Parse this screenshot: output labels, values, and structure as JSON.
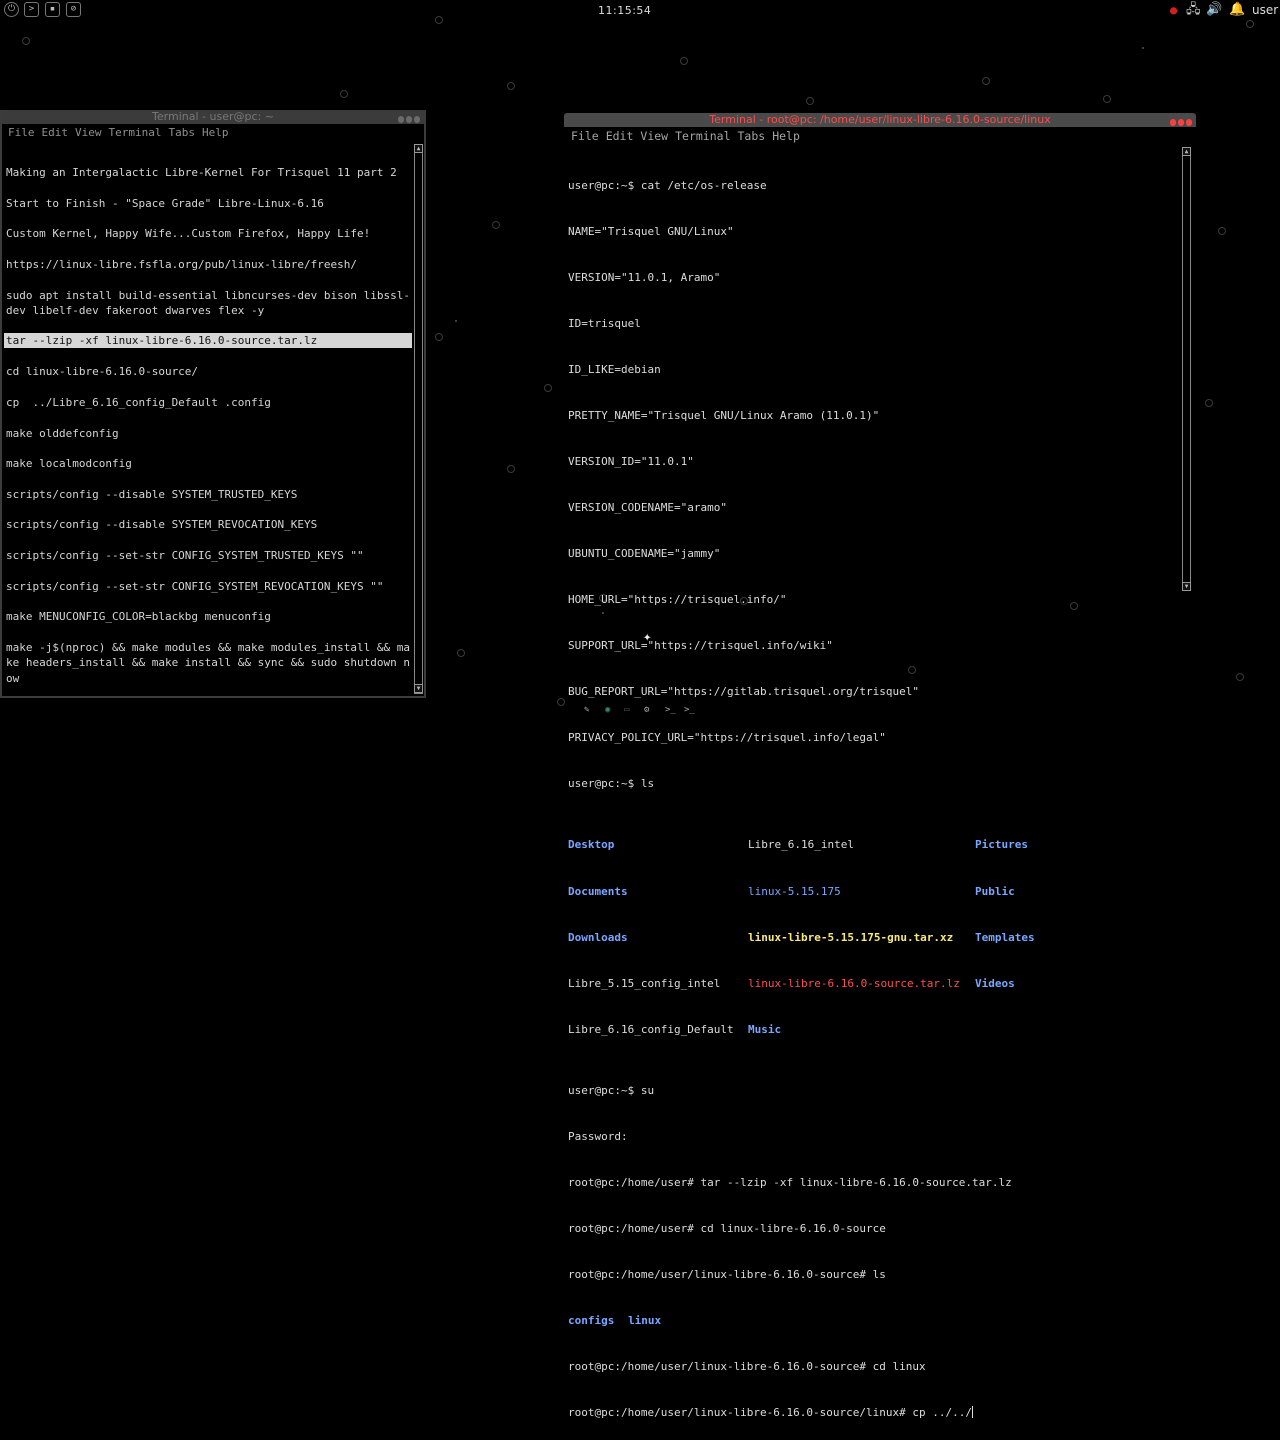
{
  "top_panel": {
    "clock": "11:15:54",
    "user": "user",
    "left_icons": [
      "power-icon",
      "terminal-icon",
      "folder-icon",
      "pen-icon"
    ],
    "tray_icons": [
      "record-icon",
      "network-icon",
      "volume-icon",
      "bell-icon"
    ]
  },
  "left_terminal": {
    "title": "Terminal - user@pc: ~",
    "menu": [
      "File",
      "Edit",
      "View",
      "Terminal",
      "Tabs",
      "Help"
    ],
    "lines": [
      "Making an Intergalactic Libre-Kernel For Trisquel 11 part 2",
      "Start to Finish - \"Space Grade\" Libre-Linux-6.16",
      "Custom Kernel, Happy Wife...Custom Firefox, Happy Life!",
      "https://linux-libre.fsfla.org/pub/linux-libre/freesh/",
      "sudo apt install build-essential libncurses-dev bison libssl-",
      "dev libelf-dev fakeroot dwarves flex -y",
      "tar --lzip -xf linux-libre-6.16.0-source.tar.lz",
      "cd linux-libre-6.16.0-source/",
      "cp  ../Libre_6.16_config_Default .config",
      "make olddefconfig",
      "make localmodconfig",
      "scripts/config --disable SYSTEM_TRUSTED_KEYS",
      "scripts/config --disable SYSTEM_REVOCATION_KEYS",
      "scripts/config --set-str CONFIG_SYSTEM_TRUSTED_KEYS \"\"",
      "scripts/config --set-str CONFIG_SYSTEM_REVOCATION_KEYS \"\"",
      "make MENUCONFIG_COLOR=blackbg menuconfig",
      "make -j$(nproc) && make modules && make modules_install && ma",
      "ke headers_install && make install && sync && sudo shutdown n",
      "ow"
    ]
  },
  "right_terminal": {
    "title": "Terminal - root@pc: /home/user/linux-libre-6.16.0-source/linux",
    "menu": [
      "File",
      "Edit",
      "View",
      "Terminal",
      "Tabs",
      "Help"
    ],
    "lines_top": [
      "user@pc:~$ cat /etc/os-release",
      "NAME=\"Trisquel GNU/Linux\"",
      "VERSION=\"11.0.1, Aramo\"",
      "ID=trisquel",
      "ID_LIKE=debian",
      "PRETTY_NAME=\"Trisquel GNU/Linux Aramo (11.0.1)\"",
      "VERSION_ID=\"11.0.1\"",
      "VERSION_CODENAME=\"aramo\"",
      "UBUNTU_CODENAME=\"jammy\"",
      "HOME_URL=\"https://trisquel.info/\"",
      "SUPPORT_URL=\"https://trisquel.info/wiki\"",
      "BUG_REPORT_URL=\"https://gitlab.trisquel.org/trisquel\"",
      "PRIVACY_POLICY_URL=\"https://trisquel.info/legal\"",
      "user@pc:~$ ls"
    ],
    "ls": {
      "col1": [
        "Desktop",
        "Documents",
        "Downloads",
        "Libre_5.15_config_intel",
        "Libre_6.16_config_Default"
      ],
      "col2": [
        "Libre_6.16_intel",
        "linux-5.15.175",
        "linux-libre-5.15.175-gnu.tar.xz",
        "linux-libre-6.16.0-source.tar.lz",
        "Music"
      ],
      "col3": [
        "Pictures",
        "Public",
        "Templates",
        "Videos"
      ]
    },
    "lines_bottom": [
      "user@pc:~$ su",
      "Password:",
      "root@pc:/home/user# tar --lzip -xf linux-libre-6.16.0-source.tar.lz",
      "root@pc:/home/user# cd linux-libre-6.16.0-source",
      "root@pc:/home/user/linux-libre-6.16.0-source# ls"
    ],
    "ls2": [
      "configs",
      "linux"
    ],
    "lines_end": [
      "root@pc:/home/user/linux-libre-6.16.0-source# cd linux",
      "root@pc:/home/user/linux-libre-6.16.0-source/linux# cp ../../"
    ]
  },
  "bottom_bar": {
    "icons": [
      "pen-icon",
      "globe-icon",
      "screen-icon",
      "gear-icon",
      "terminal-icon",
      "terminal-icon"
    ],
    "labels": [
      "✎",
      "◉",
      "▭",
      "⚙",
      ">_",
      ">_"
    ]
  },
  "colors": {
    "directory": "#7aa6ff",
    "archive": "#ff5050",
    "archive_highlight": "#f7e87a",
    "active_title": "#ff4a4a"
  }
}
